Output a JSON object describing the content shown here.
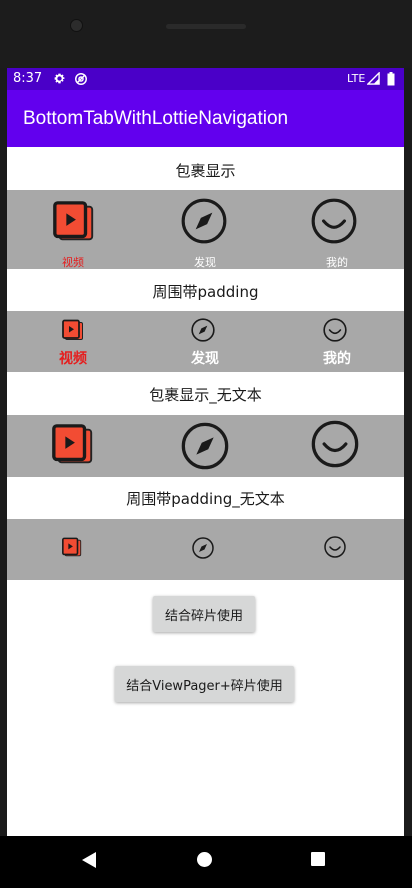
{
  "status_bar": {
    "time": "8:37",
    "network": "LTE",
    "icons": [
      "gear-icon",
      "cast-icon",
      "signal-icon",
      "battery-icon"
    ]
  },
  "app_bar": {
    "title": "BottomTabWithLottieNavigation"
  },
  "sections": [
    {
      "title": "包裹显示"
    },
    {
      "title": "周围带padding"
    },
    {
      "title": "包裹显示_无文本"
    },
    {
      "title": "周围带padding_无文本"
    }
  ],
  "tabs": {
    "video": {
      "label": "视频",
      "icon": "video-icon"
    },
    "discover": {
      "label": "发现",
      "icon": "compass-icon"
    },
    "mine": {
      "label": "我的",
      "icon": "smile-icon"
    }
  },
  "buttons": {
    "fragment": "结合碎片使用",
    "viewpager": "结合ViewPager+碎片使用"
  },
  "colors": {
    "status_bar": "#4a00c8",
    "app_bar": "#6200ee",
    "tab_bar_bg": "#a8a8a8",
    "selected_tab": "#e51e1e",
    "video_icon_fill": "#f24c33"
  },
  "nav_bar": {
    "icons": [
      "back-icon",
      "home-icon",
      "recents-icon"
    ]
  }
}
